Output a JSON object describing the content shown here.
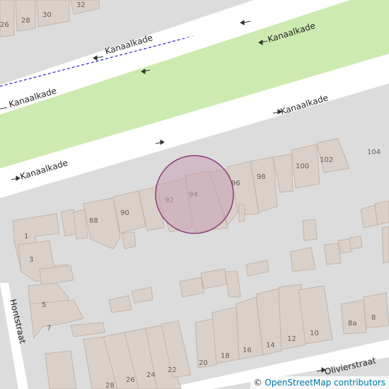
{
  "streets": {
    "kanaalkade_north_a": "Kanaalkade",
    "kanaalkade_north_b": "Kanaalkade",
    "kanaalkade_mid_left": "Kanaalkade",
    "kanaalkade_south_right": "Kanaalkade",
    "kanaalkade_south_left": "Kanaalkade",
    "hontstraat": "Hontstraat",
    "olivierstraat": "Olivierstraat"
  },
  "house_numbers": {
    "n26": "26",
    "n28": "28",
    "n30": "30",
    "n32": "32",
    "n1": "1",
    "n3": "3",
    "n5": "5",
    "n7": "7",
    "n88": "88",
    "n90": "90",
    "n92": "92",
    "n94": "94",
    "n96": "96",
    "n98": "98",
    "n100": "100",
    "n102": "102",
    "n104": "104",
    "n8a": "8a",
    "n8": "8",
    "n10": "10",
    "n12": "12",
    "n14": "14",
    "n16": "16",
    "n18": "18",
    "n20": "20",
    "n22": "22",
    "n24": "24",
    "n26b": "26",
    "n28b": "28"
  },
  "attribution": {
    "copyright": "©",
    "link_text": "OpenStreetMap contributors"
  },
  "colors": {
    "background": "#dcdcdc",
    "road": "#ffffff",
    "park": "#cdebb0",
    "building": "#d9d0c9",
    "building_outline": "#c4b6ab",
    "marker_fill": "#c8a0b4",
    "marker_stroke": "#8a3c78",
    "rail_dash": "#3434c8"
  },
  "icons": {
    "oneway_arrow": "oneway-arrow-icon"
  }
}
